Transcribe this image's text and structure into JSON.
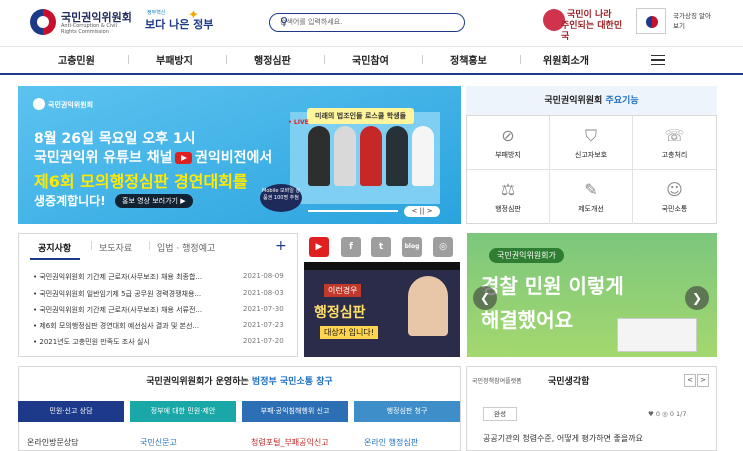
{
  "header": {
    "logo_title": "국민권익위원회",
    "logo_sub": "Anti-Corruption & Civil Rights Commission",
    "gov_small": "정부혁신",
    "gov_big": "보다 나은 정부",
    "search_placeholder": "검색어를 입력하세요.",
    "slogan_line1": "국민이 나라",
    "slogan_line2": "주인되는 대한민국",
    "symbol_label": "국가상징 알아보기"
  },
  "nav": [
    "고충민원",
    "부패방지",
    "행정심판",
    "국민참여",
    "정책홍보",
    "위원회소개"
  ],
  "banner": {
    "logo": "국민권익위원회",
    "tag": "미래의 법조인들 로스쿨 학생들",
    "live": "• LIVE",
    "line1": "8월 26일 목요일 오후 1시",
    "line2": "국민권익위 유튜브 채널",
    "line2b": "권익비전에서",
    "line3": "제6회 모의행정심판 경연대회를",
    "line4": "생중계합니다!",
    "btn": "홍보 영상 보러가기 ▶",
    "mobile": "Mobile 모바일 상품권 100명 추첨",
    "ctrl": "< || >"
  },
  "functions": {
    "title_prefix": "국민권익위원회",
    "title_accent": "주요기능",
    "items": [
      {
        "label": "부패방지",
        "icon": "no-corruption-icon",
        "glyph": "⊘"
      },
      {
        "label": "신고자보호",
        "icon": "shield-icon",
        "glyph": "⛉"
      },
      {
        "label": "고충처리",
        "icon": "complaint-icon",
        "glyph": "☏"
      },
      {
        "label": "행정심판",
        "icon": "gavel-icon",
        "glyph": "⚖"
      },
      {
        "label": "제도개선",
        "icon": "edit-doc-icon",
        "glyph": "✎"
      },
      {
        "label": "국민소통",
        "icon": "people-icon",
        "glyph": "☺"
      }
    ]
  },
  "notice": {
    "tabs": [
      "공지사항",
      "보도자료",
      "입법 · 행정예고"
    ],
    "more": "+",
    "rows": [
      {
        "title": "국민권익위원회 기간제 근로자(사무보조) 채용 최종합...",
        "date": "2021-08-09"
      },
      {
        "title": "국민권익위원회 일반임기제 5급 공무원 경력경쟁채용...",
        "date": "2021-08-03"
      },
      {
        "title": "국민권익위원회 기간제 근로자(사무보조) 채용 서류전...",
        "date": "2021-07-30"
      },
      {
        "title": "제6회 모의행정심판 경연대회 예선심사 결과 및 본선...",
        "date": "2021-07-23"
      },
      {
        "title": "2021년도 고충민원 만족도 조사 실시",
        "date": "2021-07-20"
      }
    ]
  },
  "sns": [
    {
      "name": "youtube-icon",
      "glyph": "▶",
      "color": "#e02020"
    },
    {
      "name": "facebook-icon",
      "glyph": "f",
      "color": "#9e9e9e"
    },
    {
      "name": "twitter-icon",
      "glyph": "t",
      "color": "#9e9e9e"
    },
    {
      "name": "blog-icon",
      "glyph": "blog",
      "color": "#9e9e9e"
    },
    {
      "name": "instagram-icon",
      "glyph": "◎",
      "color": "#9e9e9e"
    }
  ],
  "video": {
    "t1": "이런경우",
    "t2": "행정심판",
    "t3": "대상자 입니다!"
  },
  "right_banner": {
    "tag": "국민권익위원회가",
    "line1": "경찰 민원 이렇게",
    "line2": "해결했어요"
  },
  "comm": {
    "title_prefix": "국민권익위원회가 운영하는",
    "title_accent": "범정부 국민소통 창구",
    "buttons": [
      {
        "label": "민원·신고 상담",
        "color": "#1d3a8a",
        "link": "온라인방문상담",
        "blue": false
      },
      {
        "label": "정부에 대한 민원·제안",
        "color": "#1aa7a7",
        "link": "국민신문고",
        "blue": true
      },
      {
        "label": "부패·공익침해행위 신고",
        "color": "#2c6fb5",
        "link": "청렴포털_부패공익신고",
        "blue": false
      },
      {
        "label": "행정심판 청구",
        "color": "#3d8ec9",
        "link": "온라인 행정심판",
        "blue": true
      }
    ]
  },
  "think": {
    "small": "국민정책참여플랫폼",
    "big": "국민생각함",
    "badge": "완성",
    "stats": "♥ 0   ◎ 0   1/7",
    "question": "공공기관의 청렴수준, 어떻게 평가하면 좋을까요"
  }
}
